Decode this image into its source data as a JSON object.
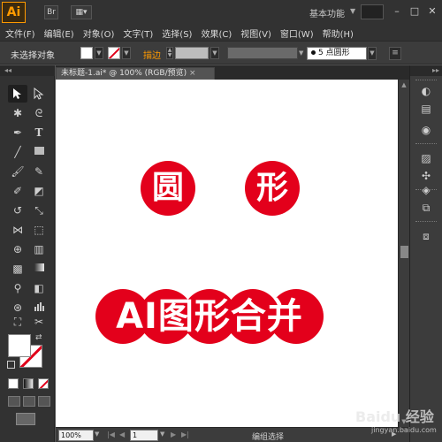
{
  "app": {
    "logo": "Ai",
    "workspace": "基本功能"
  },
  "menubar": {
    "items": [
      "文件(F)",
      "编辑(E)",
      "对象(O)",
      "文字(T)",
      "选择(S)",
      "效果(C)",
      "视图(V)",
      "窗口(W)",
      "帮助(H)"
    ]
  },
  "controlbar": {
    "selection_status": "未选择对象",
    "stroke_label": "描边",
    "brush_size": "5",
    "brush_shape": "点圆形"
  },
  "document": {
    "tab_title": "未标题-1.ai* @ 100% (RGB/预览)",
    "tab_close": "×"
  },
  "artwork": {
    "accent_color": "#e3001b",
    "top_left_glyph": "圆",
    "top_right_glyph": "形",
    "merged_text": "AI图形合并"
  },
  "statusbar": {
    "zoom": "100%",
    "page": "1",
    "status": "编组选择"
  },
  "watermark": {
    "logo": "Baidu 经验",
    "sub": "jingyan.baidu.com"
  },
  "icons": {
    "left_tools": [
      "selection-tool-icon",
      "direct-selection-tool-icon",
      "magic-wand-icon",
      "lasso-icon",
      "pen-tool-icon",
      "type-tool-icon",
      "line-tool-icon",
      "rectangle-tool-icon",
      "paintbrush-icon",
      "pencil-icon",
      "blob-brush-icon",
      "eraser-icon",
      "rotate-icon",
      "scale-icon",
      "width-tool-icon",
      "free-transform-icon",
      "shape-builder-icon",
      "perspective-grid-icon",
      "mesh-tool-icon",
      "gradient-tool-icon",
      "eyedropper-icon",
      "blend-tool-icon",
      "symbol-sprayer-icon",
      "column-graph-icon",
      "artboard-tool-icon",
      "slice-tool-icon",
      "hand-tool-icon",
      "zoom-tool-icon"
    ],
    "right_dock": [
      "color-panel-icon",
      "color-guide-icon",
      "swatches-icon",
      "brushes-icon",
      "symbols-icon",
      "layers-icon",
      "artboards-icon",
      "align-icon"
    ]
  }
}
